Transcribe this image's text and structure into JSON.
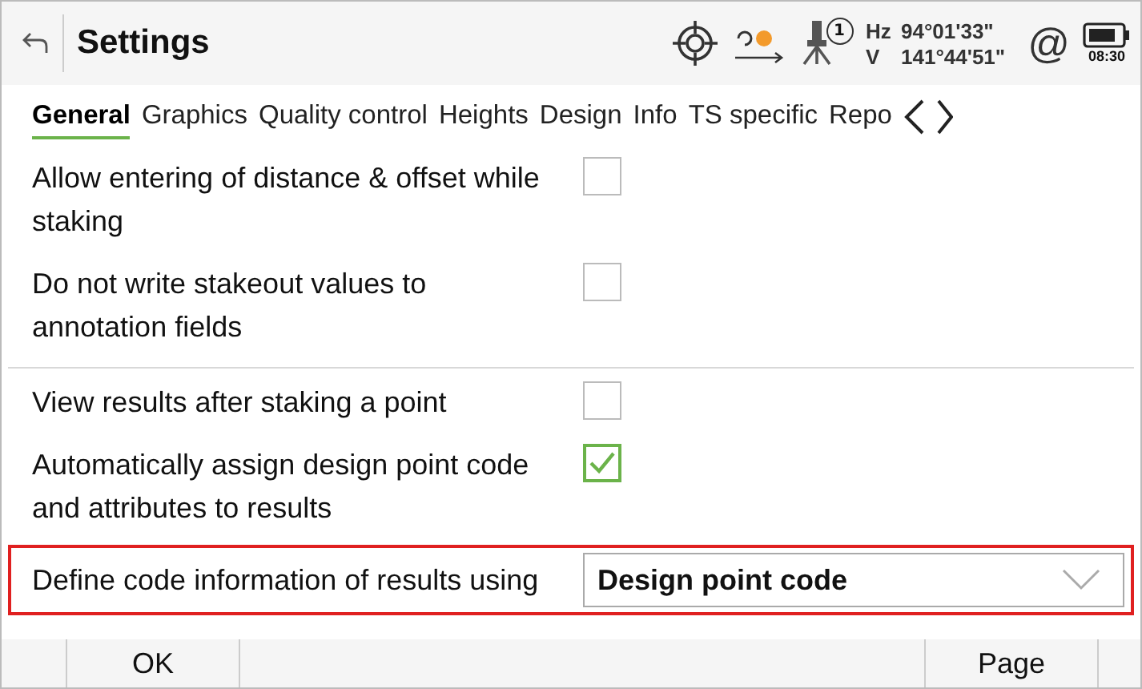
{
  "header": {
    "title": "Settings",
    "instrument_number": "1",
    "hz_label": "Hz",
    "hz_value": "94°01'33\"",
    "v_label": "V",
    "v_value": "141°44'51\"",
    "at_sign": "@",
    "time": "08:30"
  },
  "tabs": [
    {
      "label": "General",
      "selected": true
    },
    {
      "label": "Graphics",
      "selected": false
    },
    {
      "label": "Quality control",
      "selected": false
    },
    {
      "label": "Heights",
      "selected": false
    },
    {
      "label": "Design",
      "selected": false
    },
    {
      "label": "Info",
      "selected": false
    },
    {
      "label": "TS specific",
      "selected": false
    },
    {
      "label": "Repo",
      "selected": false
    }
  ],
  "rows": [
    {
      "kind": "checkbox",
      "label": "Allow entering of distance & offset while staking",
      "checked": false,
      "separated": false,
      "highlighted": false
    },
    {
      "kind": "checkbox",
      "label": "Do not write stakeout values to annotation fields",
      "checked": false,
      "separated": false,
      "highlighted": false
    },
    {
      "kind": "checkbox",
      "label": "View results after staking a point",
      "checked": false,
      "separated": true,
      "highlighted": false
    },
    {
      "kind": "checkbox",
      "label": "Automatically assign design point code and attributes to results",
      "checked": true,
      "separated": false,
      "highlighted": false
    },
    {
      "kind": "dropdown",
      "label": "Define code information of results using",
      "value": "Design point code",
      "separated": false,
      "highlighted": true
    }
  ],
  "footer": {
    "buttons": [
      "OK",
      "Page"
    ]
  }
}
